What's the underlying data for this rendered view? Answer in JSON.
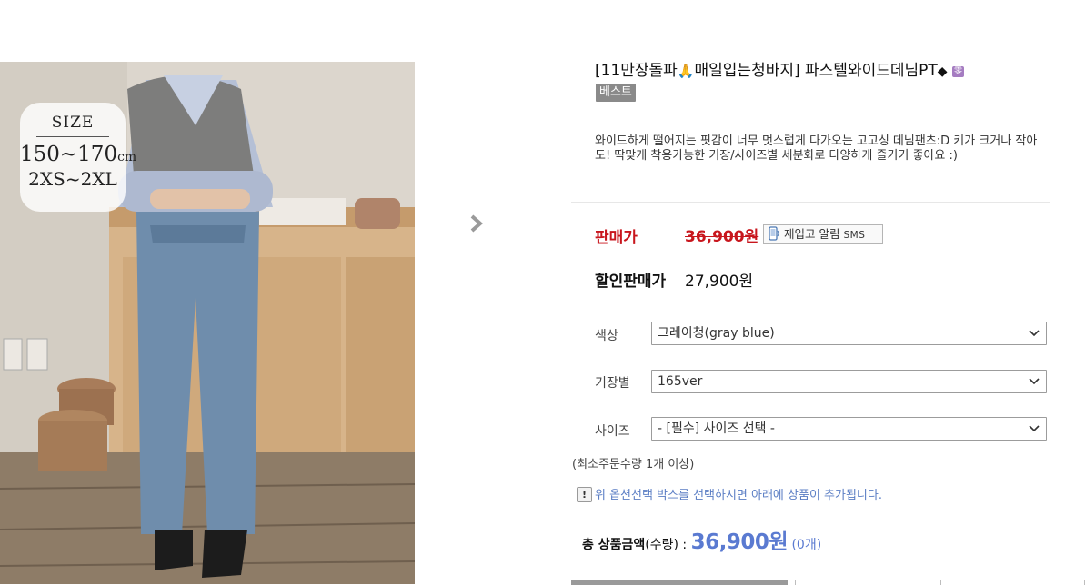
{
  "photo": {
    "size_badge": {
      "title": "SIZE",
      "range": "150~170",
      "range_unit": "cm",
      "sizes": "2XS~2XL"
    }
  },
  "product": {
    "title_part1": "[11만장돌파",
    "title_emoji": "🙏",
    "title_part2": "매일입는청바지] 파스텔와이드데님PT",
    "title_diamond": "◆",
    "zero_tag": "零",
    "best_badge": "베스트",
    "summary": "와이드하게 떨어지는 핏감이 너무 멋스럽게 다가오는 고고싱 데님팬츠:D 키가 크거나 작아도! 딱맞게 착용가능한 기장/사이즈별 세분화로 다양하게 즐기기 좋아요 :)"
  },
  "price": {
    "label": "판매가",
    "original": "36,900원",
    "restock_label": "재입고 알림",
    "restock_sms": "SMS",
    "sale_label": "할인판매가",
    "sale_value": "27,900원"
  },
  "options": [
    {
      "label": "색상",
      "value": "그레이청(gray blue)"
    },
    {
      "label": "기장별",
      "value": "165ver"
    },
    {
      "label": "사이즈",
      "value": "- [필수] 사이즈 선택 -"
    }
  ],
  "order": {
    "min_order": "(최소주문수량 1개 이상)",
    "notice": "위 옵션선택 박스를 선택하시면 아래에 상품이 추가됩니다.",
    "warn_glyph": "!",
    "total_label": "총 상품금액",
    "total_qty_label": "(수량) :",
    "total_amount": "36,900원",
    "total_count": "(0개)"
  },
  "colors": {
    "price_red": "#c8161d",
    "total_blue": "#5a7ad1",
    "notice_blue": "#5a7dc4",
    "badge_gray": "#8a8a8a"
  },
  "icons": [
    "chevron-right-icon",
    "phone-icon",
    "chevron-down-icon",
    "warning-icon"
  ]
}
